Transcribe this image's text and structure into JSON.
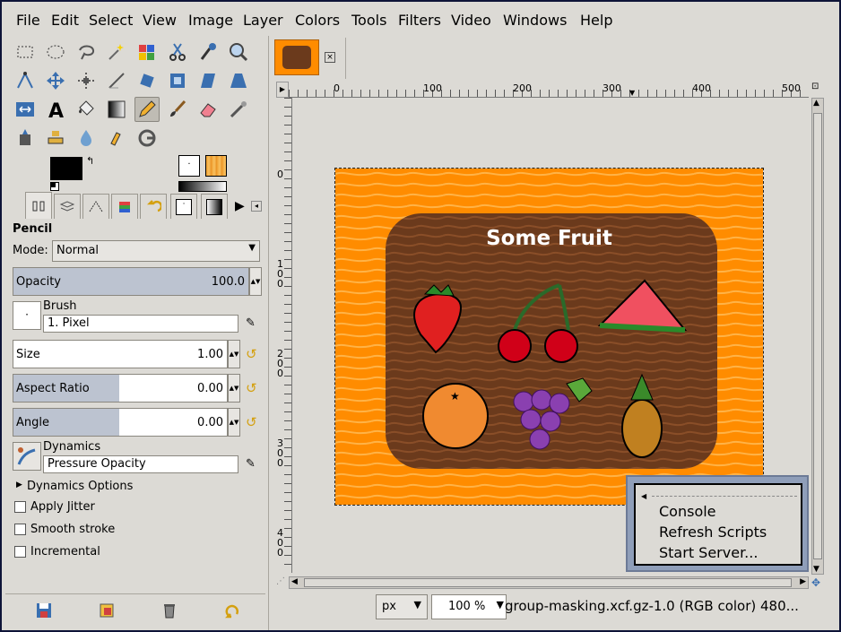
{
  "menubar": {
    "items": [
      "File",
      "Edit",
      "Select",
      "View",
      "Image",
      "Layer",
      "Colors",
      "Tools",
      "Filters",
      "Video",
      "Windows",
      "Help"
    ]
  },
  "tool_options": {
    "title": "Pencil",
    "mode_label": "Mode:",
    "mode_value": "Normal",
    "opacity_label": "Opacity",
    "opacity_value": "100.0",
    "brush_label": "Brush",
    "brush_value": "1. Pixel",
    "size_label": "Size",
    "size_value": "1.00",
    "aspect_label": "Aspect Ratio",
    "aspect_value": "0.00",
    "angle_label": "Angle",
    "angle_value": "0.00",
    "dynamics_label": "Dynamics",
    "dynamics_value": "Pressure Opacity",
    "dynamics_options": "Dynamics Options",
    "apply_jitter": "Apply Jitter",
    "smooth_stroke": "Smooth stroke",
    "incremental": "Incremental"
  },
  "ruler": {
    "h_ticks": [
      "0",
      "100",
      "200",
      "300",
      "400",
      "500"
    ],
    "v_ticks": [
      "0",
      "100",
      "200",
      "300",
      "400"
    ]
  },
  "canvas": {
    "title": "Some Fruit",
    "fruits": [
      "strawberry",
      "cherries",
      "watermelon",
      "orange",
      "grapes",
      "pineapple"
    ]
  },
  "popup": {
    "items": [
      "Console",
      "Refresh Scripts",
      "Start Server..."
    ]
  },
  "statusbar": {
    "unit": "px",
    "zoom": "100 %",
    "info": "group-masking.xcf.gz-1.0 (RGB color) 480..."
  },
  "colors": {
    "foreground": "#000000",
    "background": "#ffffff",
    "orange": "#ff8c00",
    "board": "#6b3a1c"
  }
}
